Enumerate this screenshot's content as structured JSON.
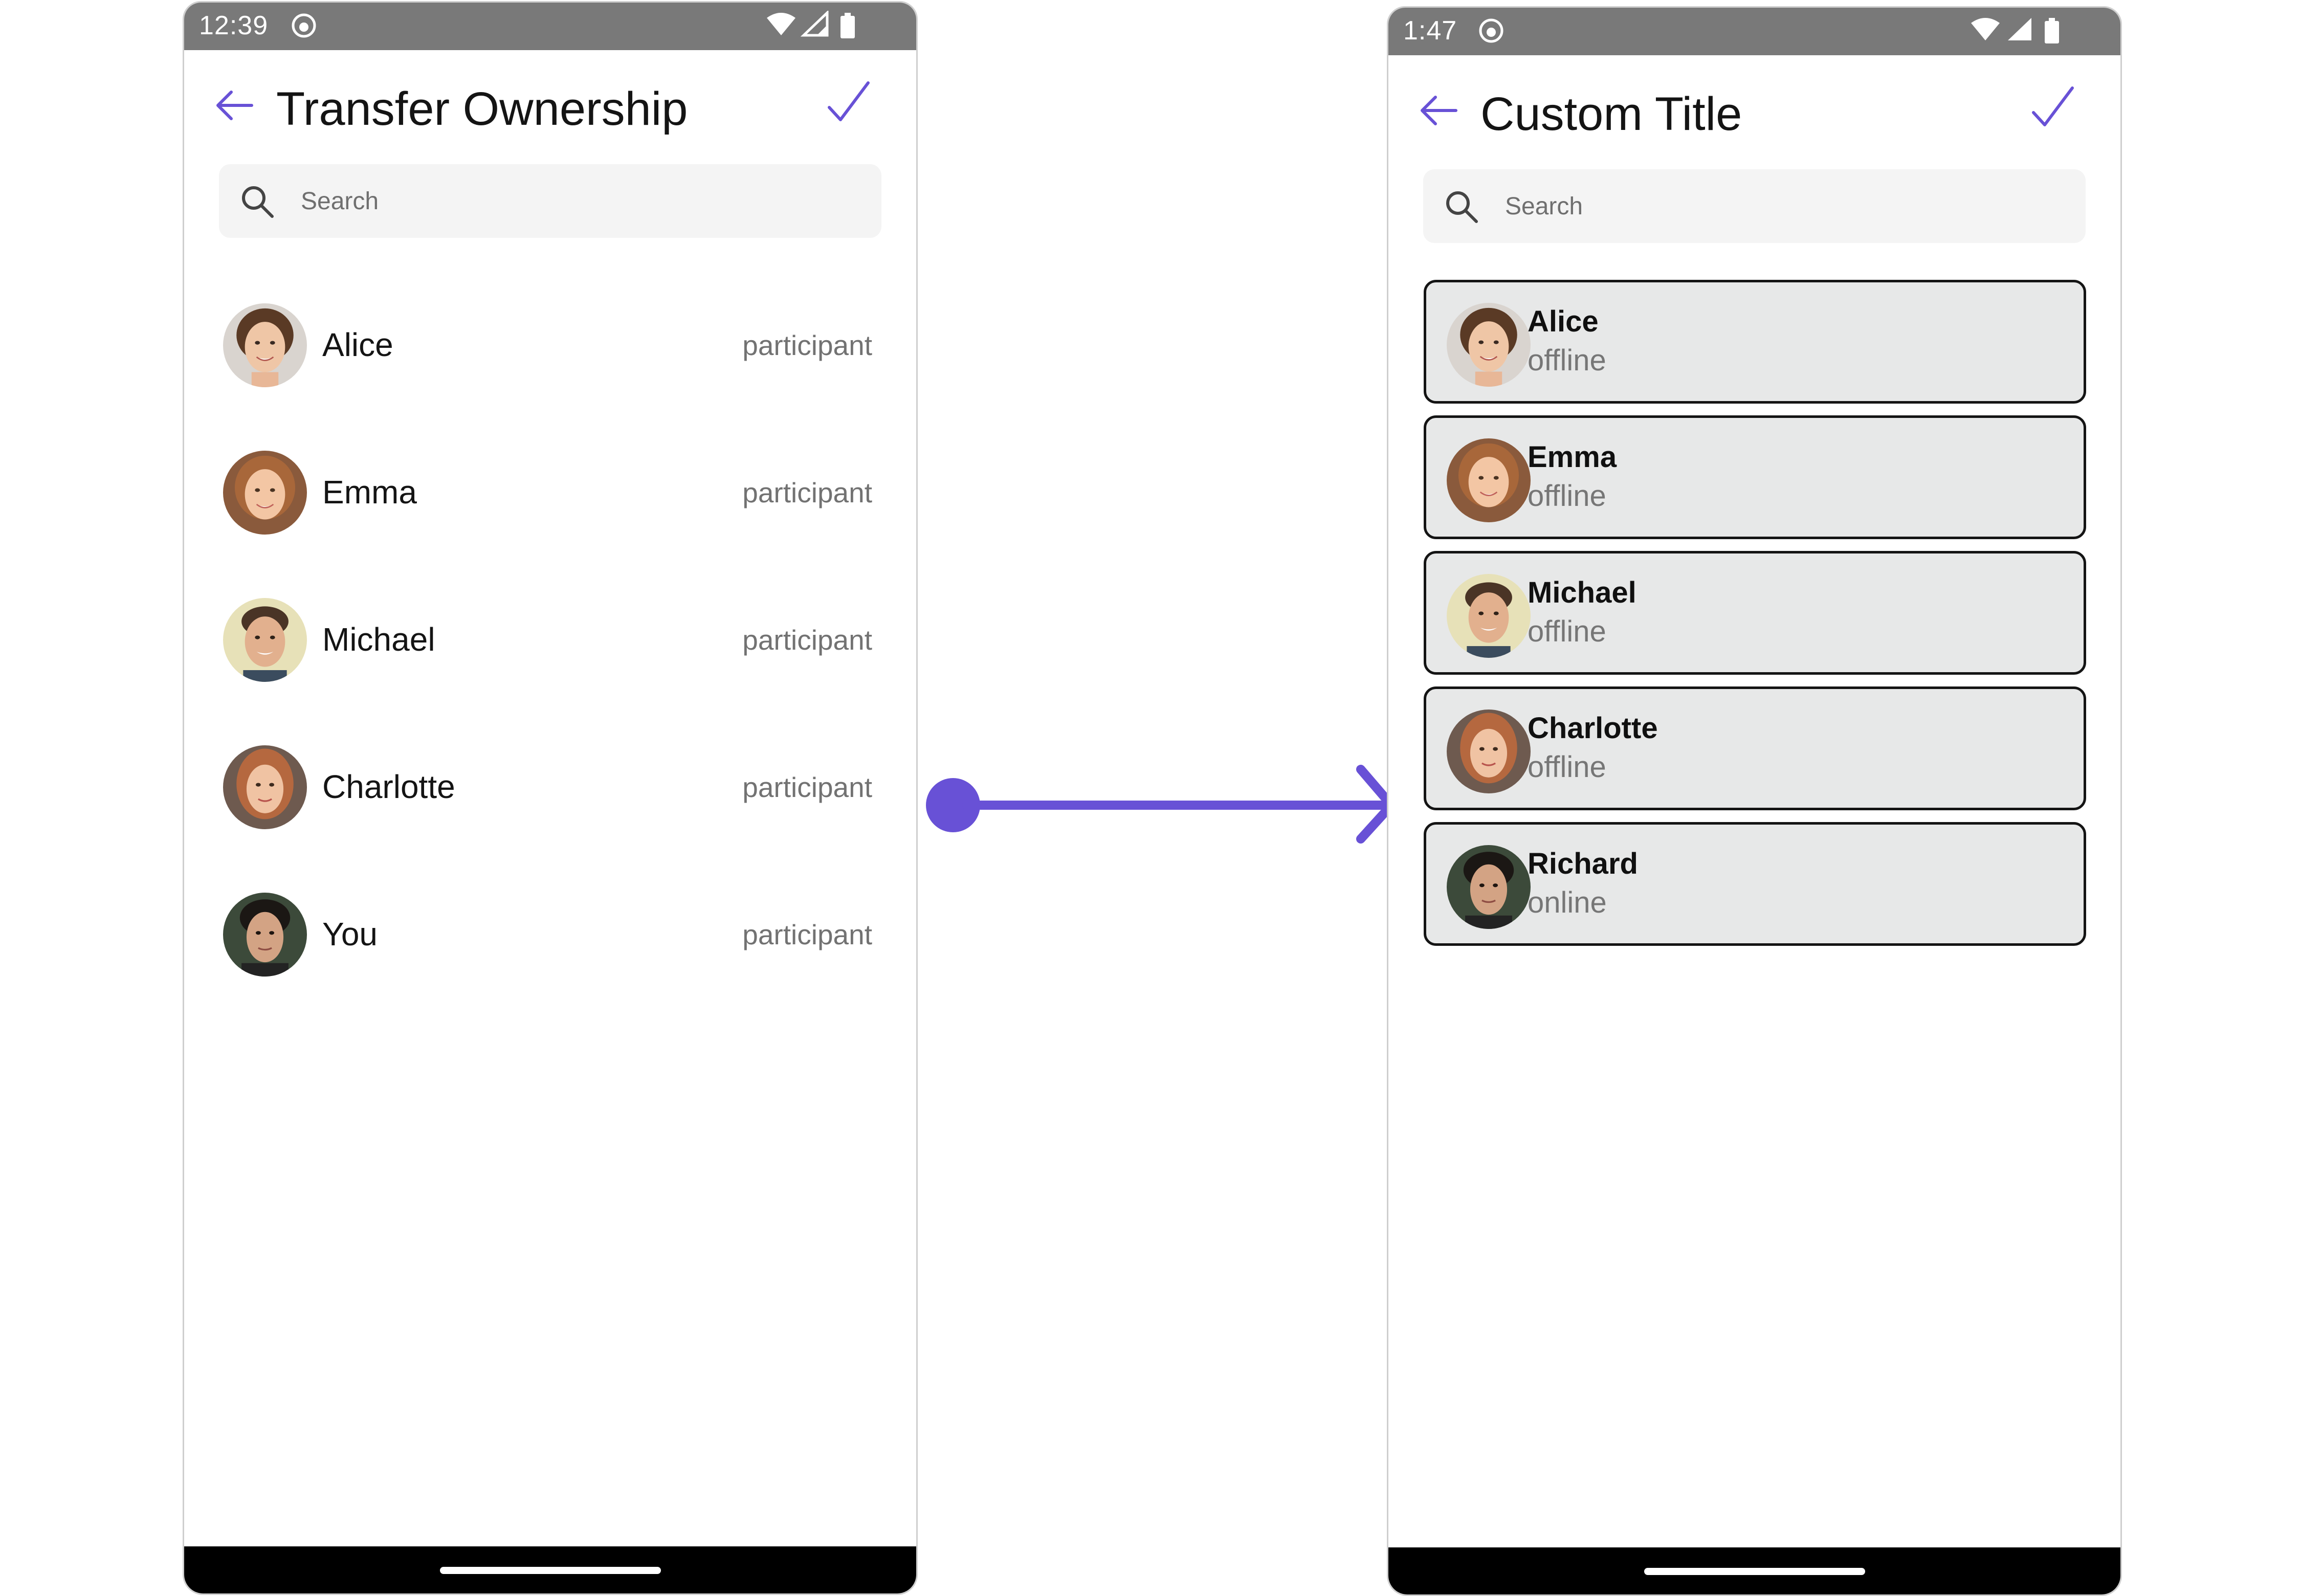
{
  "colors": {
    "accent": "#6851d6",
    "status_bar": "#797979",
    "card_background": "#e7e8e8",
    "card_border": "#141414",
    "secondary_text": "#727272"
  },
  "left_screen": {
    "status_time": "12:39",
    "title": "Transfer Ownership",
    "search": {
      "placeholder": "Search"
    },
    "members": [
      {
        "name": "Alice",
        "scope": "participant",
        "avatar": "alice-avatar"
      },
      {
        "name": "Emma",
        "scope": "participant",
        "avatar": "emma-avatar"
      },
      {
        "name": "Michael",
        "scope": "participant",
        "avatar": "michael-avatar"
      },
      {
        "name": "Charlotte",
        "scope": "participant",
        "avatar": "charlotte-avatar"
      },
      {
        "name": "You",
        "scope": "participant",
        "avatar": "you-avatar"
      }
    ]
  },
  "right_screen": {
    "status_time": "1:47",
    "title": "Custom Title",
    "search": {
      "placeholder": "Search"
    },
    "members": [
      {
        "name": "Alice",
        "status": "offline",
        "avatar": "alice-avatar"
      },
      {
        "name": "Emma",
        "status": "offline",
        "avatar": "emma-avatar"
      },
      {
        "name": "Michael",
        "status": "offline",
        "avatar": "michael-avatar"
      },
      {
        "name": "Charlotte",
        "status": "offline",
        "avatar": "charlotte-avatar"
      },
      {
        "name": "Richard",
        "status": "online",
        "avatar": "richard-avatar"
      }
    ]
  },
  "icons": [
    "back-arrow-icon",
    "checkmark-icon",
    "search-icon",
    "wifi-icon",
    "signal-icon",
    "battery-icon",
    "app-notification-icon"
  ]
}
